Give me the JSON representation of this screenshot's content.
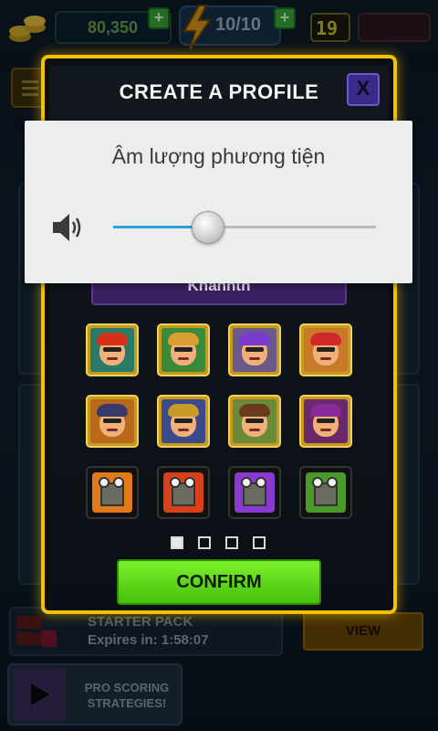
{
  "hud": {
    "coins": "80,350",
    "energy": "10/10",
    "level": "19",
    "plus_symbol": "+"
  },
  "profile_dialog": {
    "title": "CREATE A PROFILE",
    "close_label": "X",
    "name_value": "Khanhth",
    "confirm_label": "CONFIRM",
    "page_count": 4,
    "active_page": 1,
    "avatars": [
      {
        "kind": "face",
        "icon": "avatar-red-spiky-hair",
        "bg": "#2a7a6a",
        "hair": "#d83018"
      },
      {
        "kind": "face",
        "icon": "avatar-headset-gamer",
        "bg": "#3a8a3a",
        "hair": "#d8a030"
      },
      {
        "kind": "face",
        "icon": "avatar-bandana-guy",
        "bg": "#6a5a8a",
        "hair": "#7a3ad0"
      },
      {
        "kind": "face",
        "icon": "avatar-red-cap-guy",
        "bg": "#c87a2a",
        "hair": "#d02828"
      },
      {
        "kind": "face",
        "icon": "avatar-biker-cap-woman",
        "bg": "#b86a1a",
        "hair": "#3a3a6a"
      },
      {
        "kind": "face",
        "icon": "avatar-goggles-guy",
        "bg": "#3a4a8a",
        "hair": "#c89a2a"
      },
      {
        "kind": "face",
        "icon": "avatar-brunette-woman",
        "bg": "#6a8a3a",
        "hair": "#6a3a1a"
      },
      {
        "kind": "face",
        "icon": "avatar-purple-hair-guy",
        "bg": "#6a2a6a",
        "hair": "#8a2a9a"
      },
      {
        "kind": "robot",
        "icon": "avatar-robot-orange",
        "bg": "#e07a1a"
      },
      {
        "kind": "robot",
        "icon": "avatar-robot-red",
        "bg": "#d8401a"
      },
      {
        "kind": "robot",
        "icon": "avatar-robot-purple",
        "bg": "#8a3ad0"
      },
      {
        "kind": "robot",
        "icon": "avatar-robot-green",
        "bg": "#4a9a2a"
      }
    ]
  },
  "volume_overlay": {
    "title": "Âm lượng phương tiện",
    "level_fraction": 0.36,
    "accent_color": "#2fa0d8",
    "icon": "speaker-icon"
  },
  "background": {
    "starter_pack_title": "STARTER PACK",
    "starter_pack_expires": "Expires in: 1:58:07",
    "view_label": "VIEW",
    "pro_scoring_line1": "PRO SCORING",
    "pro_scoring_line2": "STRATEGIES!"
  }
}
